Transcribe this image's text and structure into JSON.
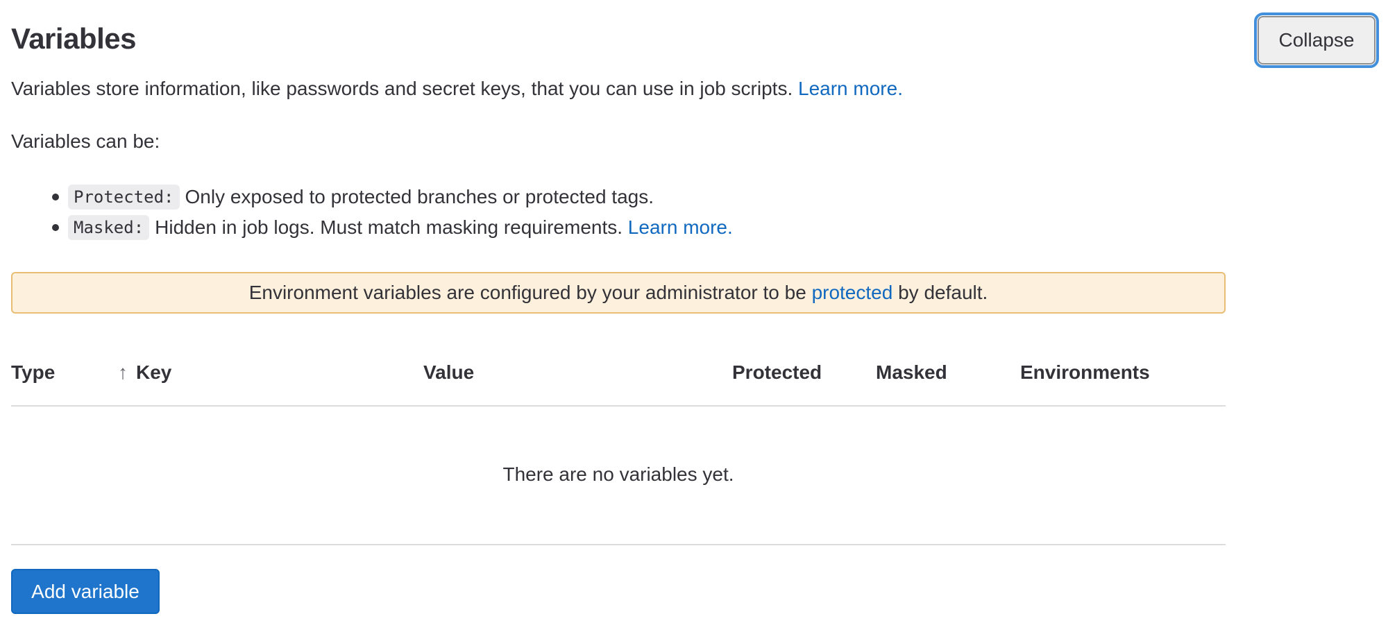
{
  "section": {
    "title": "Variables",
    "collapse_label": "Collapse",
    "description": "Variables store information, like passwords and secret keys, that you can use in job scripts.",
    "description_link": "Learn more.",
    "can_be_label": "Variables can be:",
    "bullets": [
      {
        "code": "Protected:",
        "text": "Only exposed to protected branches or protected tags.",
        "link": ""
      },
      {
        "code": "Masked:",
        "text": "Hidden in job logs. Must match masking requirements.",
        "link": "Learn more."
      }
    ]
  },
  "alert": {
    "text_before": "Environment variables are configured by your administrator to be",
    "link": "protected",
    "text_after": "by default.",
    "background": "#fdf1dd",
    "border": "#e9be74"
  },
  "table": {
    "columns": [
      {
        "label": "Type"
      },
      {
        "label": "Key",
        "sort_icon": "arrow-up-icon",
        "sort": "ascending"
      },
      {
        "label": "Value"
      },
      {
        "label": "Protected"
      },
      {
        "label": "Masked"
      },
      {
        "label": "Environments"
      }
    ],
    "rows": [],
    "empty_text": "There are no variables yet."
  },
  "add_button_label": "Add variable",
  "colors": {
    "primary": "#1f75cb",
    "link": "#1068bf",
    "text": "#333238"
  }
}
